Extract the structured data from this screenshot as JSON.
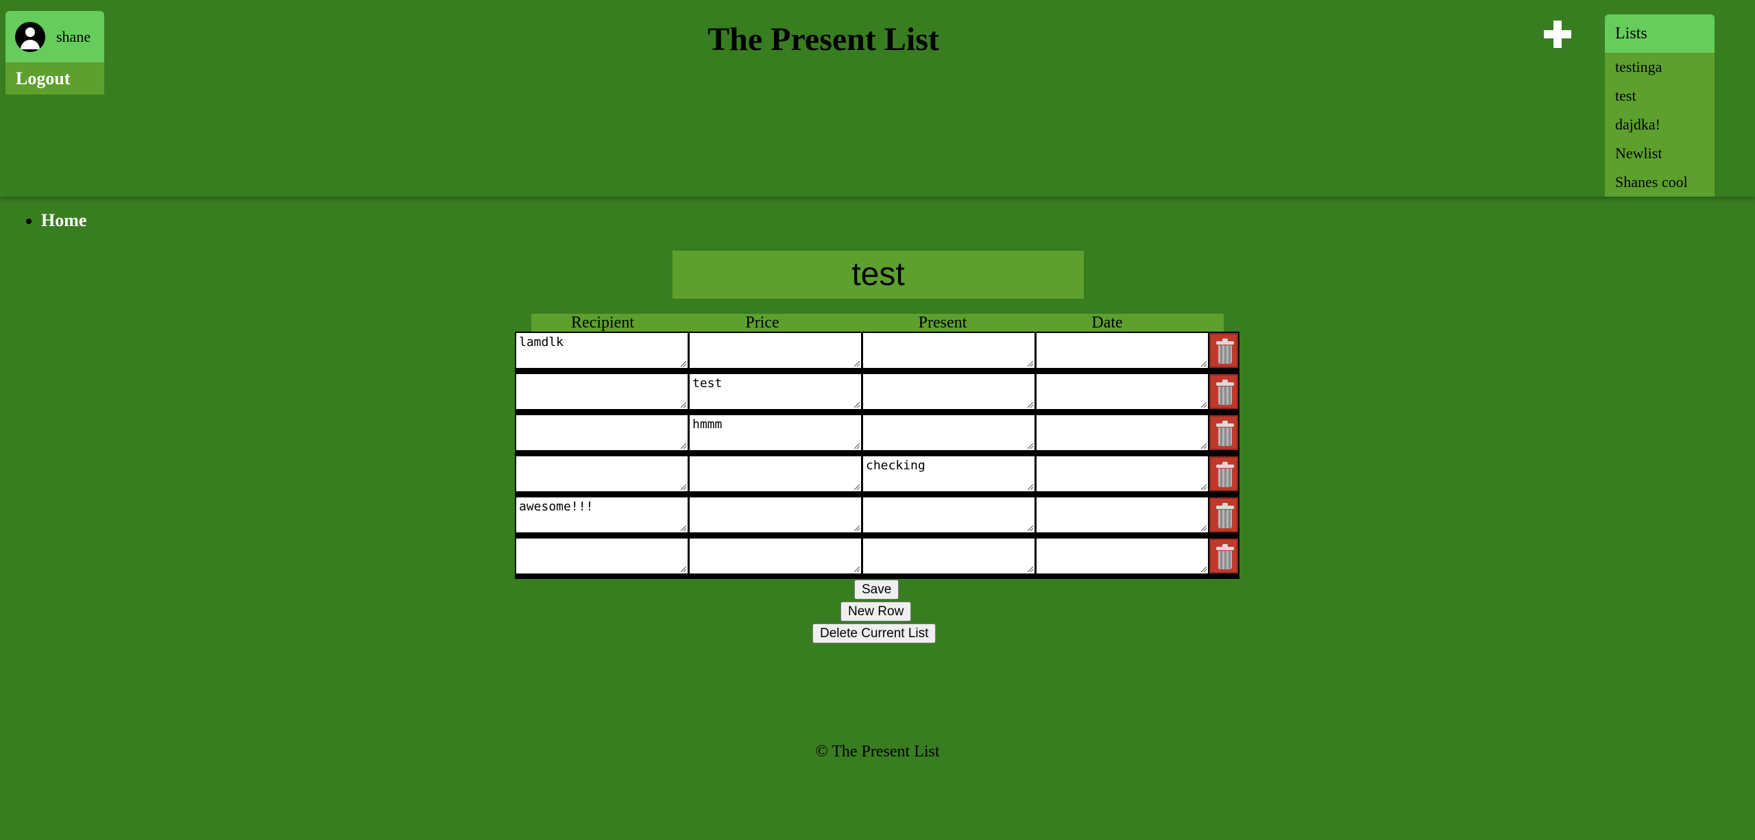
{
  "user": {
    "name": "shane",
    "logout_label": "Logout",
    "avatar_icon": "user-avatar-icon"
  },
  "header": {
    "title": "The Present List",
    "add_icon": "plus-icon"
  },
  "lists_menu": {
    "header": "Lists",
    "items": [
      "testinga",
      "test",
      "dajdka!",
      "Newlist",
      "Shanes cool"
    ]
  },
  "nav": {
    "home_label": "Home"
  },
  "list": {
    "title": "test",
    "columns": [
      "Recipient",
      "Price",
      "Present",
      "Date"
    ],
    "rows": [
      [
        "lamdlk",
        "",
        "",
        ""
      ],
      [
        "",
        "test",
        "",
        ""
      ],
      [
        "",
        "hmmm",
        "",
        ""
      ],
      [
        "",
        "",
        "checking",
        ""
      ],
      [
        "awesome!!!",
        "",
        "",
        ""
      ],
      [
        "",
        "",
        "",
        ""
      ]
    ],
    "delete_icon": "trash-icon"
  },
  "actions": {
    "save_label": "Save",
    "new_row_label": "New Row",
    "delete_list_label": "Delete Current List"
  },
  "footer": {
    "text": "© The Present List"
  },
  "colors": {
    "background": "#397D21",
    "panel": "#5DA02E",
    "highlight": "#66CC5C",
    "delete": "#C0392B"
  }
}
